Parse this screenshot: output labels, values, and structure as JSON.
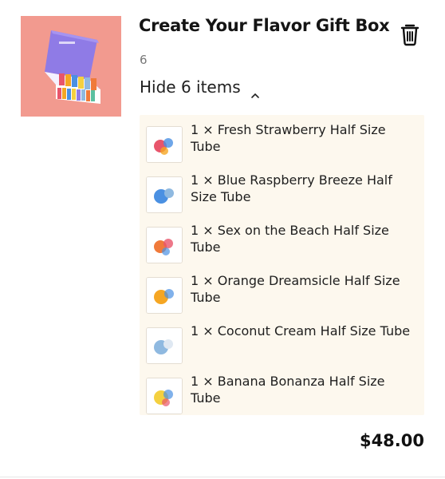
{
  "product": {
    "title": "Create Your Flavor Gift Box",
    "quantity": "6",
    "toggle_label": "Hide 6 items",
    "total": "$48.00"
  },
  "items": [
    {
      "label": "1 × Fresh Strawberry Half Size Tube",
      "color": "#e8556b"
    },
    {
      "label": "1 × Blue Raspberry Breeze Half Size Tube",
      "color": "#4a90e2"
    },
    {
      "label": "1 × Sex on the Beach Half Size Tube",
      "color": "#f07a3a"
    },
    {
      "label": "1 × Orange Dreamsicle Half Size Tube",
      "color": "#f5a623"
    },
    {
      "label": "1 × Coconut Cream Half Size Tube",
      "color": "#8fb9e0"
    },
    {
      "label": "1 × Banana Bonanza Half Size Tube",
      "color": "#f4d03f"
    }
  ],
  "icons": {
    "delete": "trash-icon",
    "toggle": "chevron-up-icon"
  },
  "colors": {
    "panel_bg": "#fdf8ee",
    "thumb_bg": "#f29a8f",
    "box_purple": "#8f7be6"
  }
}
